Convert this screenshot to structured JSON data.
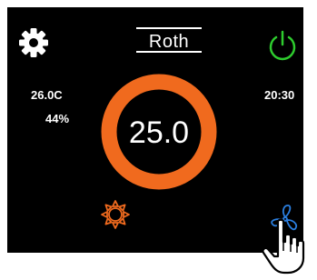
{
  "brand": {
    "name": "Roth"
  },
  "status": {
    "room_temperature": "26.0C",
    "humidity": "44%",
    "time": "20:30"
  },
  "setpoint": {
    "value": "25.0"
  },
  "icons": {
    "settings": "gear-icon",
    "power": "power-icon",
    "heat_mode": "sun-icon",
    "fan": "fan-icon",
    "pointer": "hand-pointer-icon"
  },
  "colors": {
    "background": "#000000",
    "accent_ring": "#f06a1e",
    "heat_icon": "#f06a1e",
    "power_icon": "#2ecc2e",
    "fan_icon": "#2b7fe0",
    "text": "#ffffff"
  }
}
